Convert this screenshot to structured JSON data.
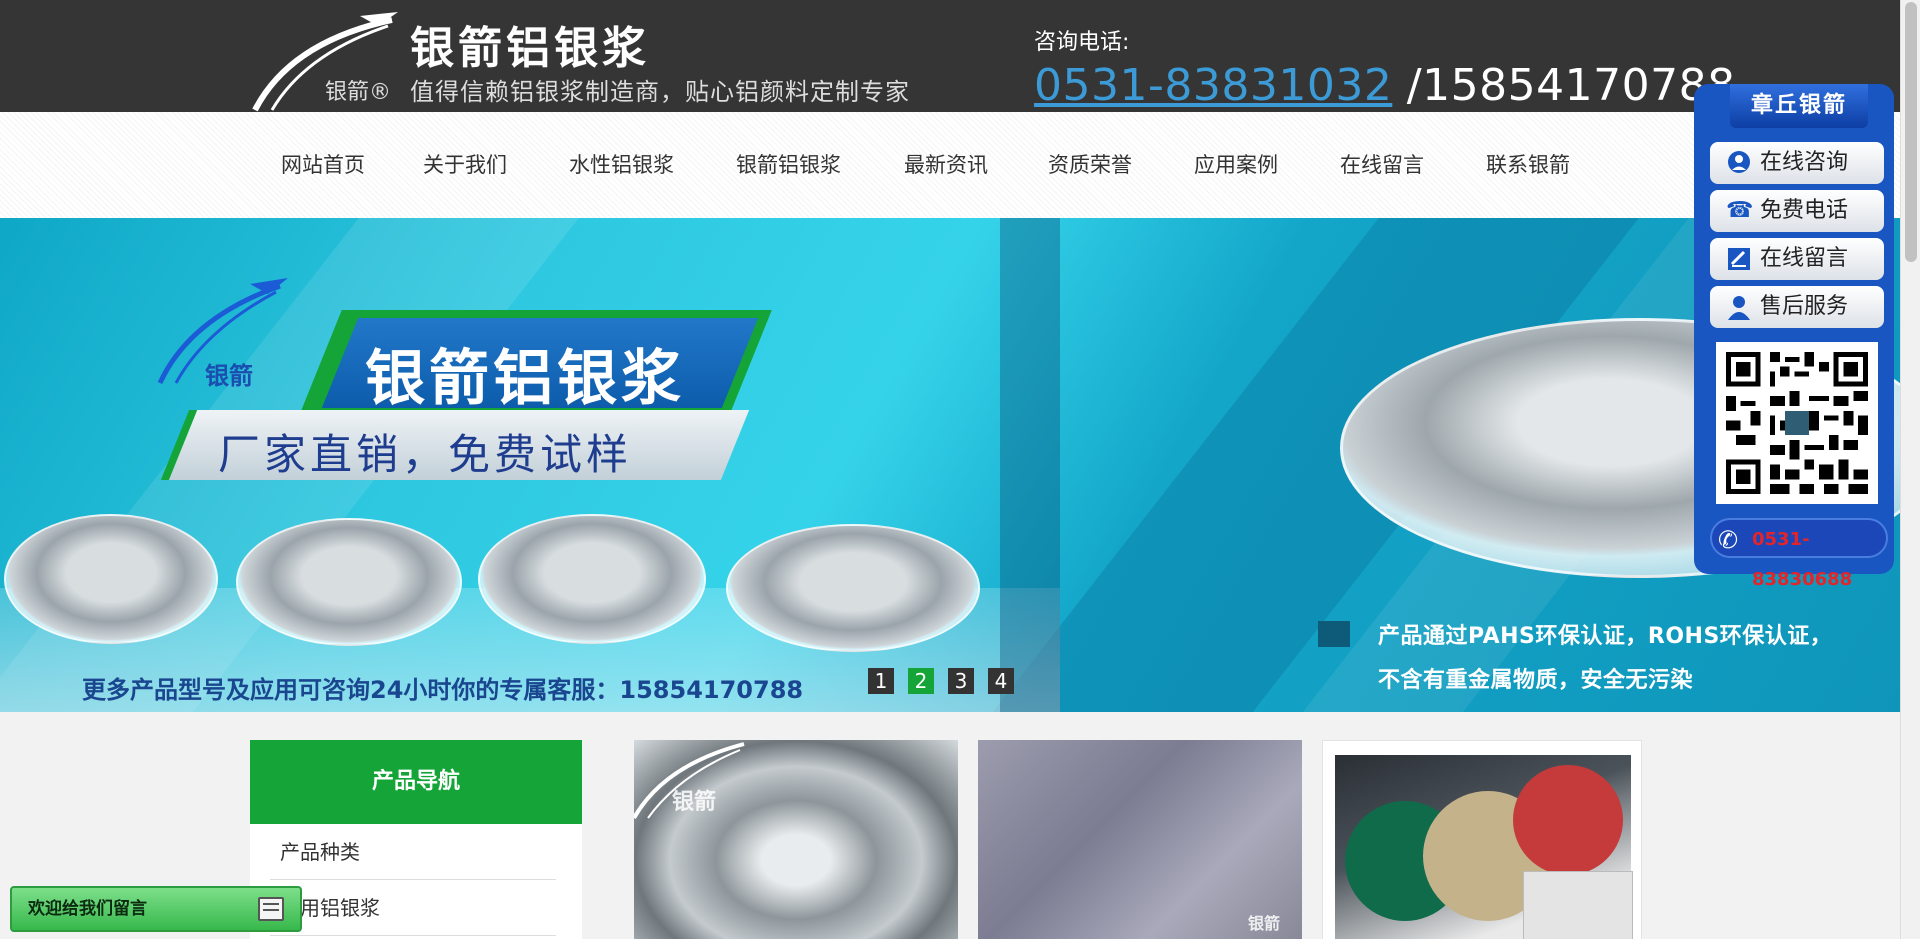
{
  "header": {
    "brand_small": "银箭®",
    "title": "银箭铝银浆",
    "slogan": "值得信赖铝银浆制造商，贴心铝颜料定制专家",
    "contact_label": "咨询电话:",
    "phone_main": "0531-83831032",
    "phone_extra": " /15854170788"
  },
  "nav": {
    "items": [
      "网站首页",
      "关于我们",
      "水性铝银浆",
      "银箭铝银浆",
      "最新资讯",
      "资质荣誉",
      "应用案例",
      "在线留言",
      "联系银箭"
    ]
  },
  "banner": {
    "brand": "银箭",
    "title": "银箭铝银浆",
    "subtitle": "厂家直销，免费试样",
    "footer": "更多产品型号及应用可咨询24小时你的专属客服：15854170788",
    "cert_line1": "产品通过PAHS环保认证，ROHS环保认证，",
    "cert_line2": "不含有重金属物质，安全无污染",
    "slides": [
      "1",
      "2",
      "3",
      "4"
    ],
    "active_slide": "2"
  },
  "side_panel": {
    "title": "章丘银箭",
    "buttons": [
      {
        "label": "在线咨询",
        "icon": "chat-bubble-icon"
      },
      {
        "label": "免费电话",
        "icon": "telephone-icon"
      },
      {
        "label": "在线留言",
        "icon": "edit-note-icon"
      },
      {
        "label": "售后服务",
        "icon": "person-icon"
      }
    ],
    "qr_icon": "qr-code-icon",
    "phone": "0531-83830688"
  },
  "sidebar_nav": {
    "title": "产品导航",
    "items": [
      "产品种类",
      "墨用铝银浆"
    ]
  },
  "products": {
    "brand_watermark": "银箭"
  },
  "chat": {
    "label": "欢迎给我们留言",
    "icon": "message-window-icon"
  },
  "colors": {
    "header_bg": "#353535",
    "brand_green": "#14a437",
    "phone_blue": "#3c9bd6",
    "panel_blue": "#1a56c2",
    "panel_phone_red": "#e3242b"
  }
}
